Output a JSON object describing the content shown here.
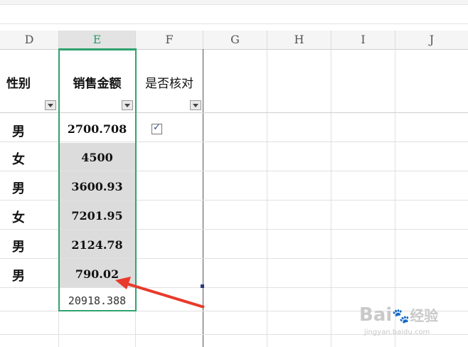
{
  "columns": [
    "D",
    "E",
    "F",
    "G",
    "H",
    "I",
    "J"
  ],
  "headers": {
    "gender": "性别",
    "sales": "销售金额",
    "verified": "是否核对"
  },
  "rows": [
    {
      "gender": "男",
      "sales": "2700.708",
      "verified": true
    },
    {
      "gender": "女",
      "sales": "4500",
      "verified": false
    },
    {
      "gender": "男",
      "sales": "3600.93",
      "verified": false
    },
    {
      "gender": "女",
      "sales": "7201.95",
      "verified": false
    },
    {
      "gender": "男",
      "sales": "2124.78",
      "verified": false
    },
    {
      "gender": "男",
      "sales": "790.02",
      "verified": false
    }
  ],
  "total": "20918.388",
  "watermark": {
    "brand": "Bai",
    "sub": "经验",
    "url": "jingyan.baidu.com"
  },
  "colors": {
    "selection": "#2fa36f",
    "arrow": "#e83a2a",
    "shade": "#dcdcdc"
  }
}
